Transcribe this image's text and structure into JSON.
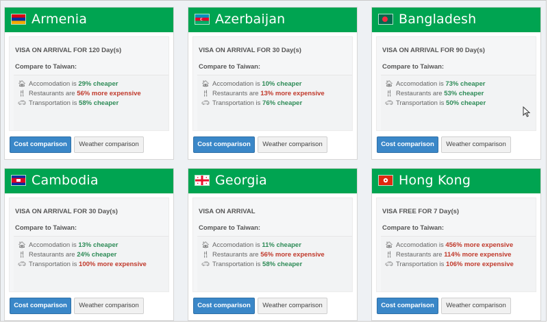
{
  "ui": {
    "compare_heading": "Compare to Taiwan:",
    "cost_button": "Cost comparison",
    "weather_button": "Weather comparison",
    "colors": {
      "header": "#00a451",
      "cheaper": "#2e8b57",
      "expensive": "#c0392b",
      "button": "#3a87c8"
    }
  },
  "cards": [
    {
      "country": "Armenia",
      "flag_icon": "armenia-flag-icon",
      "visa": "VISA ON ARRIVAL FOR 120 Day(s)",
      "accommodation": {
        "prefix": "Accomodation is",
        "value": "29% cheaper",
        "status": "cheaper"
      },
      "restaurants": {
        "prefix": "Restaurants are",
        "value": "56% more expensive",
        "status": "expensive"
      },
      "transportation": {
        "prefix": "Transportation is",
        "value": "58% cheaper",
        "status": "cheaper"
      }
    },
    {
      "country": "Azerbaijan",
      "flag_icon": "azerbaijan-flag-icon",
      "visa": "VISA ON ARRIVAL FOR 30 Day(s)",
      "accommodation": {
        "prefix": "Accomodation is",
        "value": "10% cheaper",
        "status": "cheaper"
      },
      "restaurants": {
        "prefix": "Restaurants are",
        "value": "13% more expensive",
        "status": "expensive"
      },
      "transportation": {
        "prefix": "Transportation is",
        "value": "76% cheaper",
        "status": "cheaper"
      }
    },
    {
      "country": "Bangladesh",
      "flag_icon": "bangladesh-flag-icon",
      "visa": "VISA ON ARRIVAL FOR 90 Day(s)",
      "accommodation": {
        "prefix": "Accomodation is",
        "value": "73% cheaper",
        "status": "cheaper"
      },
      "restaurants": {
        "prefix": "Restaurants are",
        "value": "53% cheaper",
        "status": "cheaper"
      },
      "transportation": {
        "prefix": "Transportation is",
        "value": "50% cheaper",
        "status": "cheaper"
      }
    },
    {
      "country": "Cambodia",
      "flag_icon": "cambodia-flag-icon",
      "visa": "VISA ON ARRIVAL FOR 30 Day(s)",
      "accommodation": {
        "prefix": "Accomodation is",
        "value": "13% cheaper",
        "status": "cheaper"
      },
      "restaurants": {
        "prefix": "Restaurants are",
        "value": "24% cheaper",
        "status": "cheaper"
      },
      "transportation": {
        "prefix": "Transportation is",
        "value": "100% more expensive",
        "status": "expensive"
      }
    },
    {
      "country": "Georgia",
      "flag_icon": "georgia-flag-icon",
      "visa": "VISA ON ARRIVAL",
      "accommodation": {
        "prefix": "Accomodation is",
        "value": "11% cheaper",
        "status": "cheaper"
      },
      "restaurants": {
        "prefix": "Restaurants are",
        "value": "56% more expensive",
        "status": "expensive"
      },
      "transportation": {
        "prefix": "Transportation is",
        "value": "58% cheaper",
        "status": "cheaper"
      }
    },
    {
      "country": "Hong Kong",
      "flag_icon": "hong-kong-flag-icon",
      "visa": "VISA FREE FOR 7 Day(s)",
      "accommodation": {
        "prefix": "Accomodation is",
        "value": "456% more expensive",
        "status": "expensive"
      },
      "restaurants": {
        "prefix": "Restaurants are",
        "value": "114% more expensive",
        "status": "expensive"
      },
      "transportation": {
        "prefix": "Transportation is",
        "value": "106% more expensive",
        "status": "expensive"
      }
    }
  ]
}
